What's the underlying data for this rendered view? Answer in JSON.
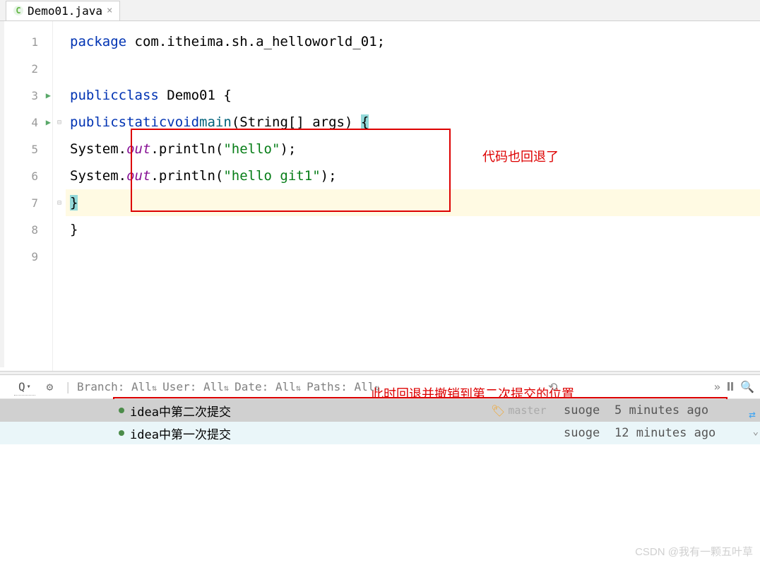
{
  "tab": {
    "filename": "Demo01.java",
    "close": "×"
  },
  "lines": [
    "1",
    "2",
    "3",
    "4",
    "5",
    "6",
    "7",
    "8",
    "9"
  ],
  "code": {
    "l1": {
      "kw": "package",
      "rest": " com.itheima.sh.a_helloworld_01;"
    },
    "l3": {
      "kw1": "public",
      "kw2": "class",
      "name": " Demo01 {"
    },
    "l4": {
      "kw1": "public",
      "kw2": "static",
      "kw3": "void",
      "method": "main",
      "params": "(String[] args) ",
      "brace": "{"
    },
    "l5": {
      "sys": "System.",
      "out": "out",
      "rest": ".println(",
      "str": "\"hello\"",
      "end": ");"
    },
    "l6": {
      "sys": "System.",
      "out": "out",
      "rest": ".println(",
      "str": "\"hello git1\"",
      "end": ");"
    },
    "l7": {
      "brace": "}"
    },
    "l8": {
      "brace": "}"
    }
  },
  "annotations": {
    "a1": "代码也回退了",
    "a2": "此时回退并撤销到第二次提交的位置"
  },
  "vcs": {
    "branch_label": "Branch:",
    "user_label": "User:",
    "date_label": "Date:",
    "paths_label": "Paths:",
    "all": "All",
    "more": "»",
    "commits": [
      {
        "msg": "idea中第二次提交",
        "branch": "master",
        "author": "suoge",
        "date": "5 minutes ago"
      },
      {
        "msg": "idea中第一次提交",
        "branch": "",
        "author": "suoge",
        "date": "12 minutes ago"
      }
    ]
  },
  "watermark": "CSDN @我有一颗五叶草"
}
